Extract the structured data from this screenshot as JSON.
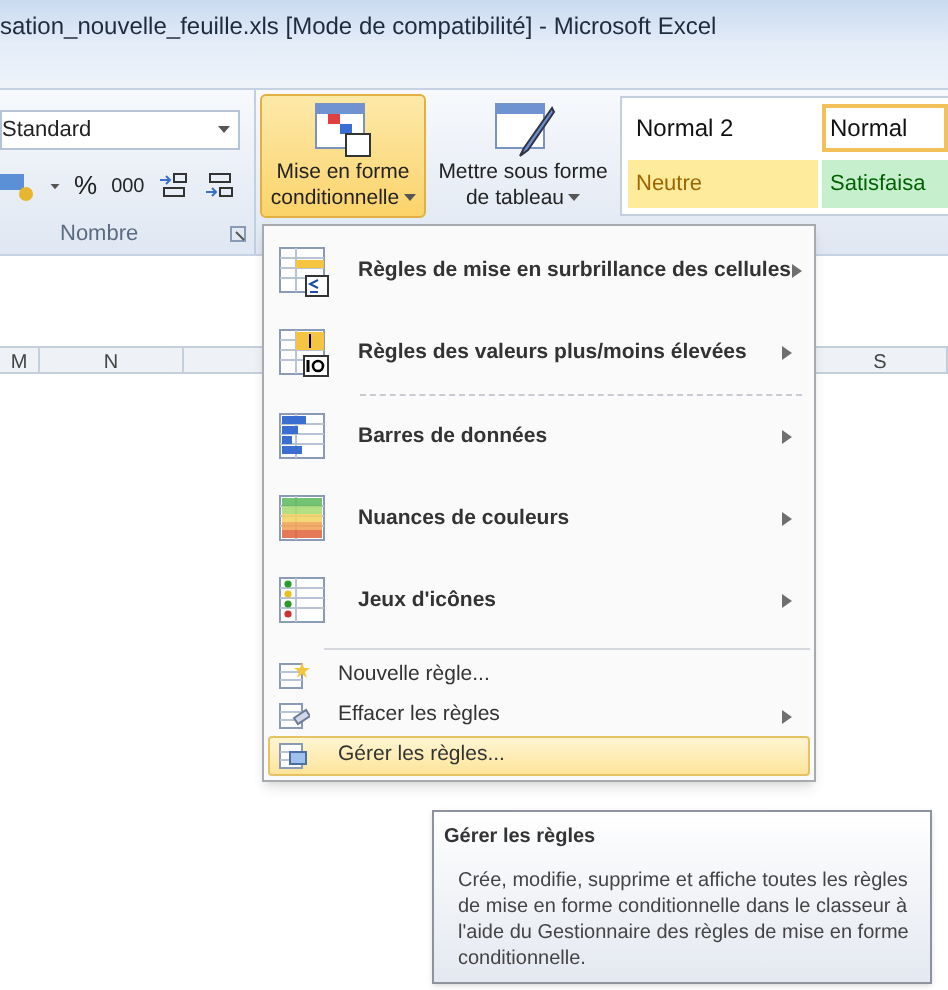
{
  "window": {
    "title": "sation_nouvelle_feuille.xls  [Mode de compatibilité]  -  Microsoft Excel"
  },
  "number_group": {
    "format": "Standard",
    "percent": "%",
    "thousands": "000",
    "label": "Nombre"
  },
  "buttons": [
    {
      "label": "Mise en forme\nconditionnelle",
      "selected": true
    },
    {
      "label": "Mettre sous forme\nde tableau",
      "selected": false
    }
  ],
  "styles": [
    {
      "label": "Normal 2",
      "kind": "plain",
      "selected": false
    },
    {
      "label": "Normal",
      "kind": "plain",
      "selected": true
    },
    {
      "label": "Neutre",
      "kind": "neutral",
      "selected": false
    },
    {
      "label": "Satisfaisa",
      "kind": "good",
      "selected": false
    }
  ],
  "columns": [
    "M",
    "N",
    "S"
  ],
  "menu": {
    "items": [
      {
        "label": "Règles de mise en surbrillance des cellules",
        "kind": "large",
        "submenu": true,
        "selected": false
      },
      {
        "label": "Règles des valeurs plus/moins élevées",
        "kind": "large",
        "submenu": true,
        "selected": false
      },
      {
        "label": "Barres de données",
        "kind": "large",
        "submenu": true,
        "selected": false
      },
      {
        "label": "Nuances de couleurs",
        "kind": "large",
        "submenu": true,
        "selected": false
      },
      {
        "label": "Jeux d'icônes",
        "kind": "large",
        "submenu": true,
        "selected": false
      },
      {
        "label": "Nouvelle règle...",
        "kind": "small",
        "submenu": false,
        "selected": false
      },
      {
        "label": "Effacer les règles",
        "kind": "small",
        "submenu": true,
        "selected": false
      },
      {
        "label": "Gérer les règles...",
        "kind": "small",
        "submenu": false,
        "selected": true
      }
    ]
  },
  "tooltip": {
    "title": "Gérer les règles",
    "body": "Crée, modifie, supprime et affiche toutes les règles de mise en forme conditionnelle dans le classeur à l'aide du Gestionnaire des règles de mise en forme conditionnelle."
  }
}
